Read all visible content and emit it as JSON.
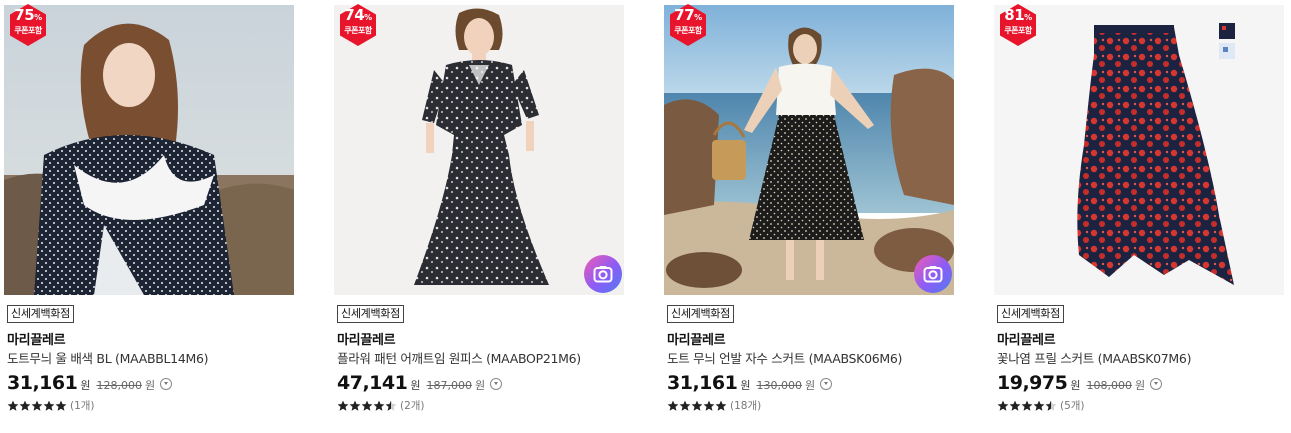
{
  "products": [
    {
      "discount": "75",
      "discount_unit": "%",
      "coupon": "쿠폰포함",
      "store": "신세계백화점",
      "brand": "마리끌레르",
      "name": "도트무늬 울 배색 BL (MAABBL14M6)",
      "price": "31,161",
      "currency": "원",
      "original_price": "128,000",
      "rating": 5,
      "reviews": "(1개)",
      "has_camera": false
    },
    {
      "discount": "74",
      "discount_unit": "%",
      "coupon": "쿠폰포함",
      "store": "신세계백화점",
      "brand": "마리끌레르",
      "name": "플라워 패턴 어깨트임 원피스 (MAABOP21M6)",
      "price": "47,141",
      "currency": "원",
      "original_price": "187,000",
      "rating": 4.5,
      "reviews": "(2개)",
      "has_camera": true
    },
    {
      "discount": "77",
      "discount_unit": "%",
      "coupon": "쿠폰포함",
      "store": "신세계백화점",
      "brand": "마리끌레르",
      "name": "도트 무늬 언발 자수 스커트 (MAABSK06M6)",
      "price": "31,161",
      "currency": "원",
      "original_price": "130,000",
      "rating": 5,
      "reviews": "(18개)",
      "has_camera": true
    },
    {
      "discount": "81",
      "discount_unit": "%",
      "coupon": "쿠폰포함",
      "store": "신세계백화점",
      "brand": "마리끌레르",
      "name": "꽃나염 프릴 스커트 (MAABSK07M6)",
      "price": "19,975",
      "currency": "원",
      "original_price": "108,000",
      "rating": 4.5,
      "reviews": "(5개)",
      "has_camera": false
    }
  ],
  "colors": {
    "badge": "#e8142c",
    "star": "#222222",
    "camera_gradient": [
      "#f15bb5",
      "#8b5cf6",
      "#4f7df0"
    ]
  },
  "icons": {
    "camera": "camera-icon",
    "info": "info-dropdown-icon",
    "star": "star-icon"
  }
}
